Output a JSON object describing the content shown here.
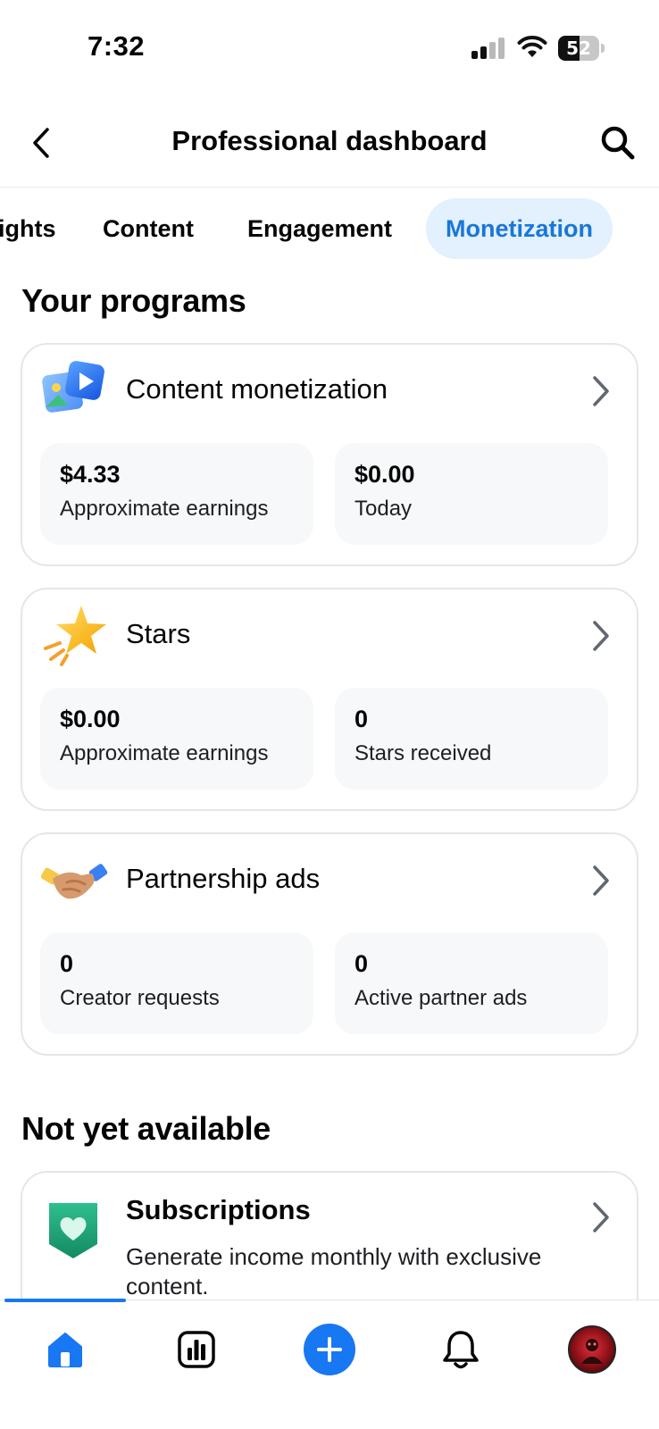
{
  "status_bar": {
    "time": "7:32",
    "battery_percent": "52",
    "battery_level": 0.52,
    "signal_bars_active": 2,
    "signal_bars_total": 4
  },
  "header": {
    "title": "Professional dashboard",
    "back_icon": "chevron-left-icon",
    "search_icon": "search-icon"
  },
  "tabs": [
    {
      "label": "ights"
    },
    {
      "label": "Content"
    },
    {
      "label": "Engagement"
    },
    {
      "label": "Monetization",
      "active": true
    }
  ],
  "colors": {
    "accent": "#1877f2",
    "active_tab_bg": "#e3f0fd",
    "active_tab_text": "#1877d8",
    "card_border": "#e4e6eb",
    "stat_bg": "#f7f8fa"
  },
  "programs_section": {
    "title": "Your programs",
    "cards": [
      {
        "title": "Content monetization",
        "icon": "photo-video-icon",
        "stats": [
          {
            "value": "$4.33",
            "label": "Approximate earnings"
          },
          {
            "value": "$0.00",
            "label": "Today"
          }
        ]
      },
      {
        "title": "Stars",
        "icon": "star-icon",
        "stats": [
          {
            "value": "$0.00",
            "label": "Approximate earnings"
          },
          {
            "value": "0",
            "label": "Stars received"
          }
        ]
      },
      {
        "title": "Partnership ads",
        "icon": "handshake-icon",
        "stats": [
          {
            "value": "0",
            "label": "Creator requests"
          },
          {
            "value": "0",
            "label": "Active partner ads"
          }
        ]
      }
    ]
  },
  "not_available_section": {
    "title": "Not yet available",
    "cards": [
      {
        "title": "Subscriptions",
        "description": "Generate income monthly with exclusive content.",
        "icon": "heart-shield-icon"
      }
    ]
  },
  "bottom_nav": {
    "items": [
      {
        "name": "home",
        "icon": "home-icon",
        "active": true
      },
      {
        "name": "insights",
        "icon": "bar-chart-icon"
      },
      {
        "name": "create",
        "icon": "plus-icon"
      },
      {
        "name": "notifications",
        "icon": "bell-icon"
      },
      {
        "name": "profile",
        "icon": "avatar-icon"
      }
    ]
  }
}
